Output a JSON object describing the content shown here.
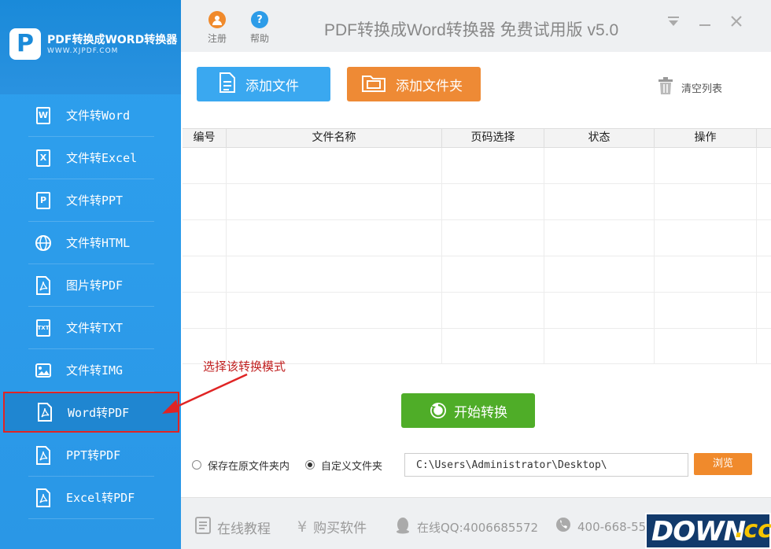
{
  "sidebar": {
    "logo_letter": "P",
    "logo_title": "PDF转换成WORD转换器",
    "logo_url": "WWW.XJPDF.COM",
    "items": [
      {
        "label": "文件转Word",
        "icon_char": "W"
      },
      {
        "label": "文件转Excel",
        "icon_char": "X"
      },
      {
        "label": "文件转PPT",
        "icon_char": "P"
      },
      {
        "label": "文件转HTML",
        "icon_char": ""
      },
      {
        "label": "图片转PDF",
        "icon_char": ""
      },
      {
        "label": "文件转TXT",
        "icon_char": "TXT"
      },
      {
        "label": "文件转IMG",
        "icon_char": ""
      },
      {
        "label": "Word转PDF",
        "icon_char": ""
      },
      {
        "label": "PPT转PDF",
        "icon_char": ""
      },
      {
        "label": "Excel转PDF",
        "icon_char": ""
      }
    ],
    "selected_index": 7
  },
  "topbar": {
    "register_label": "注册",
    "help_label": "帮助",
    "help_char": "?",
    "title": "PDF转换成Word转换器 免费试用版 v5.0"
  },
  "actions": {
    "add_file": "添加文件",
    "add_folder": "添加文件夹",
    "clear_list": "清空列表"
  },
  "table": {
    "columns": [
      "编号",
      "文件名称",
      "页码选择",
      "状态",
      "操作"
    ],
    "rows": []
  },
  "annotation": "选择该转换模式",
  "convert": {
    "start_label": "开始转换"
  },
  "output": {
    "option_original": "保存在原文件夹内",
    "option_custom": "自定义文件夹",
    "selected": "custom",
    "path_value": "C:\\Users\\Administrator\\Desktop\\",
    "browse_label": "浏览"
  },
  "footer": {
    "tutorial": "在线教程",
    "buy": "购买软件",
    "qq": "在线QQ:4006685572",
    "phone": "400-668-55"
  },
  "watermark": {
    "down": "DOWN",
    "cc": ".cc"
  },
  "colors": {
    "sidebar_blue": "#2ea0ee",
    "add_file_blue": "#3aa8f0",
    "add_folder_orange": "#ee8a35",
    "start_green": "#4fad28",
    "browse_orange": "#f08a2c",
    "highlight_red": "#e02424"
  }
}
